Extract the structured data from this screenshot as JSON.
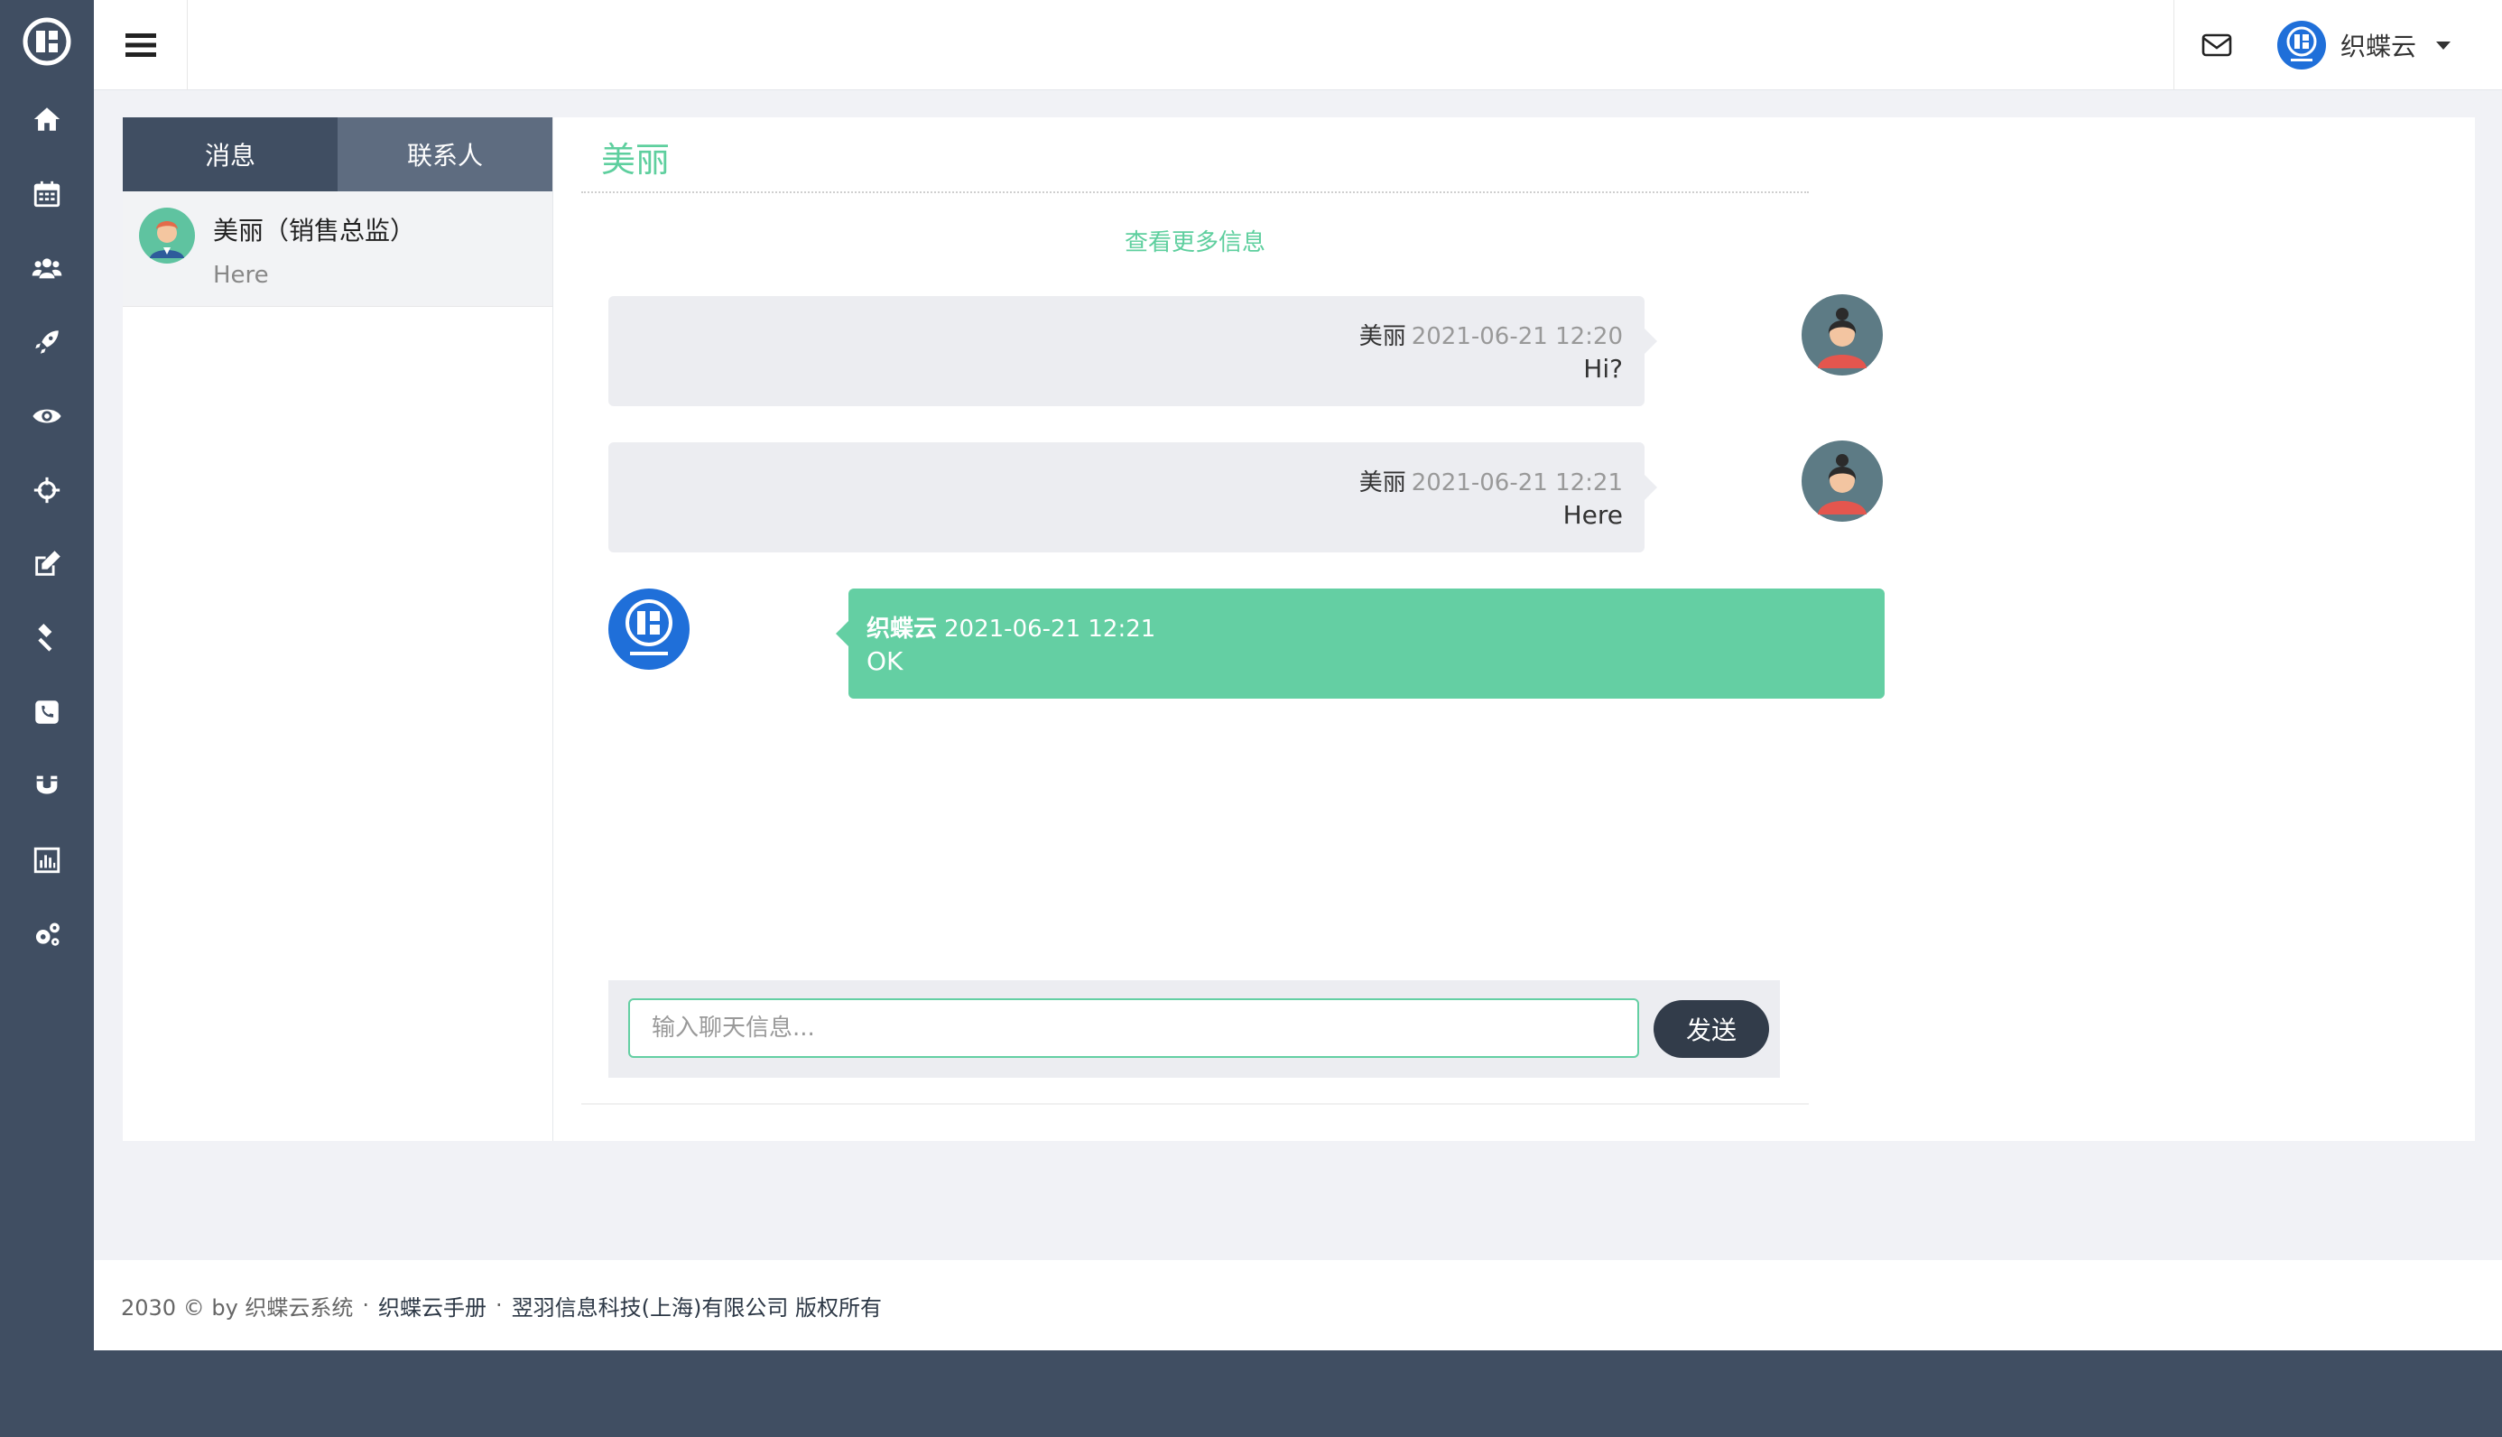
{
  "brand": {
    "name": "织蝶云"
  },
  "sidebar": {
    "icons": [
      "logo-icon",
      "home-icon",
      "calendar-icon",
      "users-icon",
      "rocket-icon",
      "eye-icon",
      "crosshair-icon",
      "edit-icon",
      "gavel-icon",
      "phone-icon",
      "magnet-icon",
      "bar-chart-icon",
      "cogs-icon"
    ]
  },
  "topbar": {
    "user_name": "织蝶云"
  },
  "tabs": [
    {
      "label": "消息"
    },
    {
      "label": "联系人"
    }
  ],
  "contacts": [
    {
      "name": "美丽（销售总监）",
      "last_message": "Here"
    }
  ],
  "chat": {
    "title": "美丽",
    "more_link": "查看更多信息",
    "messages": [
      {
        "sender": "美丽",
        "time": "2021-06-21 12:20",
        "text": "Hi?"
      },
      {
        "sender": "美丽",
        "time": "2021-06-21 12:21",
        "text": "Here"
      },
      {
        "sender": "织蝶云",
        "time": "2021-06-21 12:21",
        "text": "OK"
      }
    ],
    "input_placeholder": "输入聊天信息...",
    "send_label": "发送"
  },
  "footer": {
    "copyright": "2030 © by 织蝶云系统",
    "manual_link": "织蝶云手册",
    "company": "翌羽信息科技(上海)有限公司 版权所有",
    "separator": "·"
  },
  "colors": {
    "sidebar_bg": "#404e62",
    "accent_green": "#64cfa3",
    "send_button": "#323c4a"
  }
}
